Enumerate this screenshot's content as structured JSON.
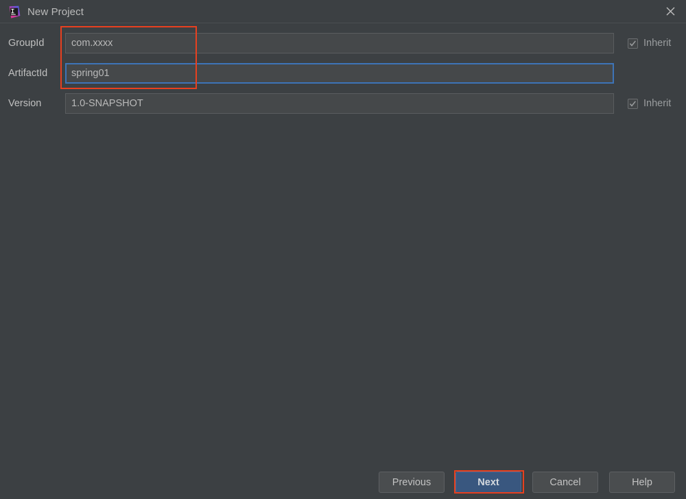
{
  "window": {
    "title": "New Project",
    "app_icon": "intellij-idea-logo",
    "close_icon": "close-icon"
  },
  "form": {
    "rows": [
      {
        "label": "GroupId",
        "value": "com.xxxx",
        "focused": false,
        "inherit": {
          "label": "Inherit",
          "checked": true,
          "enabled": false
        }
      },
      {
        "label": "ArtifactId",
        "value": "spring01",
        "focused": true,
        "inherit": null
      },
      {
        "label": "Version",
        "value": "1.0-SNAPSHOT",
        "focused": false,
        "inherit": {
          "label": "Inherit",
          "checked": true,
          "enabled": false
        }
      }
    ]
  },
  "buttons": {
    "previous": "Previous",
    "next": "Next",
    "cancel": "Cancel",
    "help": "Help"
  },
  "annotations": {
    "color": "#e8401f",
    "fields_box": "highlight-groupid-artifactid",
    "next_box": "highlight-next-button"
  },
  "colors": {
    "background": "#3c4043",
    "field_background": "#45484a",
    "field_border": "#5a5d5f",
    "focus_border": "#3d74b8",
    "primary_button": "#39577f",
    "text": "#c0c0c0",
    "annotation": "#e8401f"
  }
}
